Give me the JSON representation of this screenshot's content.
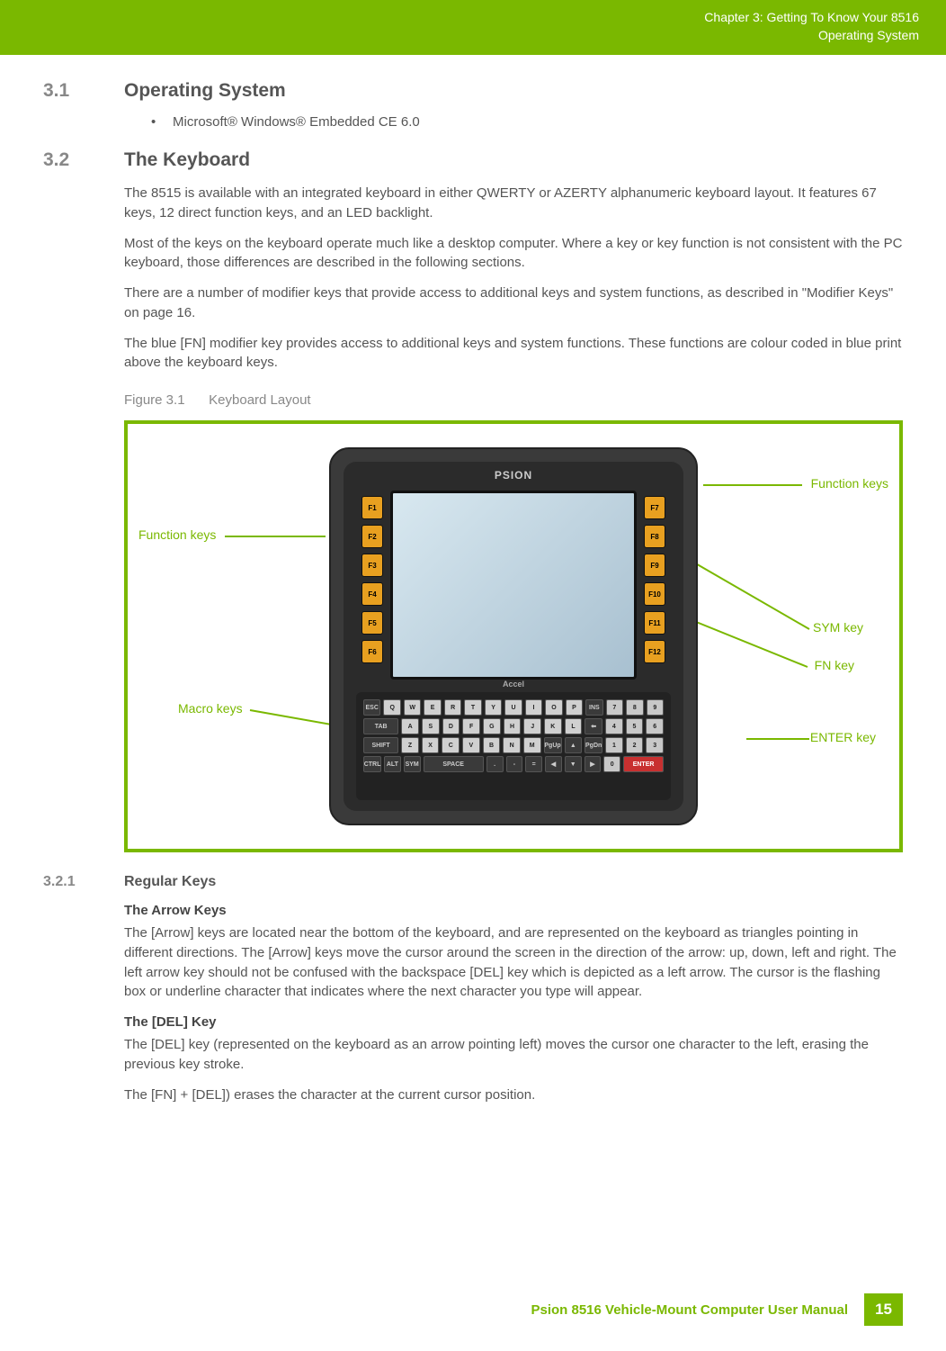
{
  "header": {
    "chapter": "Chapter 3:  Getting To Know Your 8516",
    "sub": "Operating System"
  },
  "sections": {
    "s31_num": "3.1",
    "s31_title": "Operating System",
    "s31_bullet": "Microsoft® Windows® Embedded CE 6.0",
    "s32_num": "3.2",
    "s32_title": "The Keyboard",
    "s32_p1": "The 8515 is available with an integrated keyboard in either QWERTY or AZERTY alphanumeric keyboard layout. It features 67 keys, 12 direct function keys, and an LED backlight.",
    "s32_p2": "Most of the keys on the keyboard operate much like a desktop computer. Where a key or key function is not consistent with the PC keyboard, those differences are described in the following sections.",
    "s32_p3": "There are a number of modifier keys that provide access to additional keys and system functions, as described in \"Modifier Keys\" on page 16.",
    "s32_p4": "The blue [FN] modifier key provides access to additional keys and system functions. These functions are colour coded in blue print above the keyboard keys.",
    "fig_num": "Figure 3.1",
    "fig_title": "Keyboard Layout",
    "s321_num": "3.2.1",
    "s321_title": "Regular Keys",
    "arrow_head": "The Arrow Keys",
    "arrow_p": "The [Arrow] keys are located near the bottom of the keyboard, and are represented on the keyboard as triangles pointing in different directions. The [Arrow] keys move the cursor around the screen in the direction of the arrow: up, down, left and right. The left arrow key should not be confused with the backspace [DEL] key which is depicted as a left arrow. The cursor is the flashing box or underline character that indicates where the next character you type will appear.",
    "del_head": "The [DEL] Key",
    "del_p1": "The [DEL] key (represented on the keyboard as an arrow pointing left) moves the cursor one character to the left, erasing the previous key stroke.",
    "del_p2": "The [FN] + [DEL]) erases the character at the current cursor position."
  },
  "figure": {
    "brand": "PSION",
    "accel": "Accel",
    "fkeys_left": [
      "F1",
      "F2",
      "F3",
      "F4",
      "F5",
      "F6"
    ],
    "fkeys_right": [
      "F7",
      "F8",
      "F9",
      "F10",
      "F11",
      "F12"
    ],
    "callout_fn_left": "Function keys",
    "callout_fn_right": "Function keys",
    "callout_sym": "SYM key",
    "callout_fnkey": "FN key",
    "callout_macro": "Macro keys",
    "callout_enter": "ENTER key"
  },
  "footer": {
    "text": "Psion 8516 Vehicle-Mount Computer User Manual",
    "page": "15"
  }
}
